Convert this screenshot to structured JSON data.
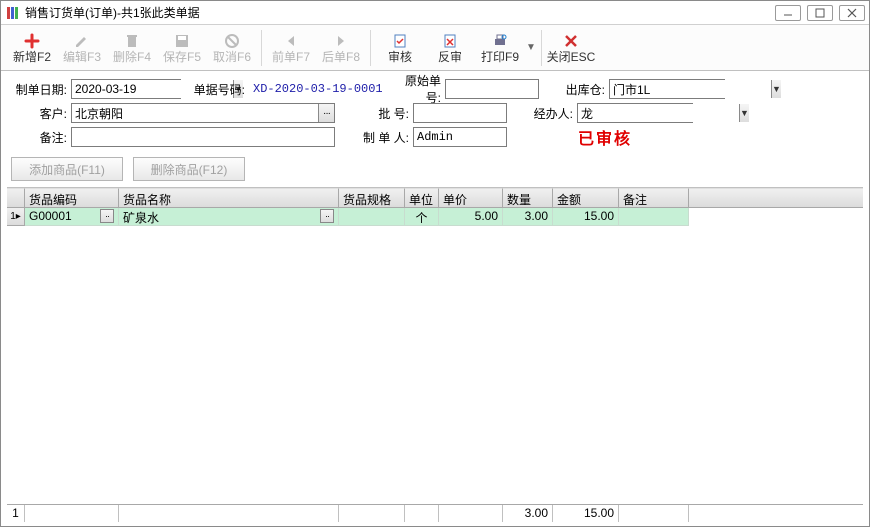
{
  "title": "销售订货单(订单)-共1张此类单据",
  "toolbar": {
    "add": "新增F2",
    "edit": "编辑F3",
    "del": "删除F4",
    "save": "保存F5",
    "cancel": "取消F6",
    "prev": "前单F7",
    "next": "后单F8",
    "approve": "审核",
    "unapprove": "反审",
    "print": "打印F9",
    "close": "关闭ESC"
  },
  "form": {
    "date_label": "制单日期:",
    "date": "2020-03-19",
    "doc_no_label": "单据号码:",
    "doc_no": "XD-2020-03-19-0001",
    "orig_label": "原始单号:",
    "orig": "",
    "out_wh_label": "出库仓:",
    "out_wh": "门市1L",
    "cust_label": "客户:",
    "cust": "北京朝阳",
    "batch_label": "批    号:",
    "batch": "",
    "handler_label": "经办人:",
    "handler": "龙",
    "memo_label": "备注:",
    "memo": "",
    "maker_label": "制 单 人:",
    "maker": "Admin",
    "stamp": "已审核"
  },
  "buttons": {
    "add_item": "添加商品(F11)",
    "del_item": "删除商品(F12)"
  },
  "grid": {
    "headers": {
      "code": "货品编码",
      "name": "货品名称",
      "spec": "货品规格",
      "unit": "单位",
      "price": "单价",
      "qty": "数量",
      "amt": "金额",
      "memo": "备注"
    },
    "rows": [
      {
        "idx": "1",
        "code": "G00001",
        "name": "矿泉水",
        "spec": "",
        "unit": "个",
        "price": "5.00",
        "qty": "3.00",
        "amt": "15.00",
        "memo": ""
      }
    ],
    "footer": {
      "idx": "1",
      "qty": "3.00",
      "amt": "15.00"
    }
  }
}
